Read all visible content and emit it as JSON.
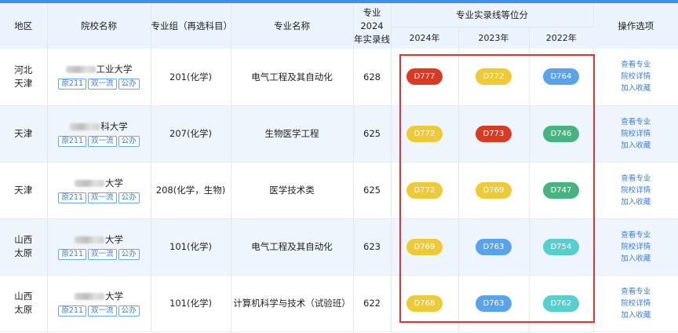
{
  "header": {
    "region": "地区",
    "school": "院校名称",
    "group": "专业组（再选科目）",
    "major": "专业名称",
    "line2024_a": "专业2024",
    "line2024_b": "年实录线",
    "rank_group": "专业实录线等位分",
    "year_2024": "2024年",
    "year_2023": "2023年",
    "year_2022": "2022年",
    "ops": "操作选项"
  },
  "ops_labels": {
    "view_major": "查看专业",
    "school_detail": "院校详情",
    "add_fav": "加入收藏"
  },
  "colors": {
    "red": "#d83b22",
    "yellow": "#eecb36",
    "blue": "#5aa3ec",
    "green": "#46b381",
    "cyan": "#58cfcf"
  },
  "rows": [
    {
      "region_line1": "河北",
      "region_line2": "天津",
      "school_suffix": "工业大学",
      "tags": [
        "原211",
        "双一流",
        "公办"
      ],
      "group": "201(化学)",
      "major": "电气工程及其自动化",
      "line2024": "628",
      "ranks": [
        {
          "value": "D777",
          "color": "red"
        },
        {
          "value": "D772",
          "color": "yellow"
        },
        {
          "value": "D764",
          "color": "blue"
        }
      ]
    },
    {
      "region_line1": "天津",
      "region_line2": "",
      "school_suffix": "科大学",
      "tags": [
        "原211",
        "双一流",
        "公办"
      ],
      "group": "207(化学)",
      "major": "生物医学工程",
      "line2024": "625",
      "ranks": [
        {
          "value": "D772",
          "color": "yellow"
        },
        {
          "value": "D773",
          "color": "red"
        },
        {
          "value": "D746",
          "color": "green"
        }
      ]
    },
    {
      "region_line1": "天津",
      "region_line2": "",
      "school_suffix": "大学",
      "tags": [
        "原211",
        "双一流",
        "公办"
      ],
      "group": "208(化学，生物)",
      "major": "医学技术类",
      "line2024": "625",
      "ranks": [
        {
          "value": "D772",
          "color": "yellow"
        },
        {
          "value": "D769",
          "color": "yellow"
        },
        {
          "value": "D747",
          "color": "green"
        }
      ]
    },
    {
      "region_line1": "山西",
      "region_line2": "太原",
      "school_suffix": "大学",
      "tags": [
        "原211",
        "双一流",
        "公办"
      ],
      "group": "101(化学)",
      "major": "电气工程及其自动化",
      "line2024": "623",
      "ranks": [
        {
          "value": "D769",
          "color": "yellow"
        },
        {
          "value": "D763",
          "color": "blue"
        },
        {
          "value": "D754",
          "color": "cyan"
        }
      ]
    },
    {
      "region_line1": "山西",
      "region_line2": "太原",
      "school_suffix": "大学",
      "tags": [
        "原211",
        "双一流",
        "公办"
      ],
      "group": "101(化学)",
      "major": "计算机科学与技术（试验班）",
      "line2024": "622",
      "ranks": [
        {
          "value": "D768",
          "color": "yellow"
        },
        {
          "value": "D763",
          "color": "blue"
        },
        {
          "value": "D762",
          "color": "cyan"
        }
      ]
    }
  ]
}
